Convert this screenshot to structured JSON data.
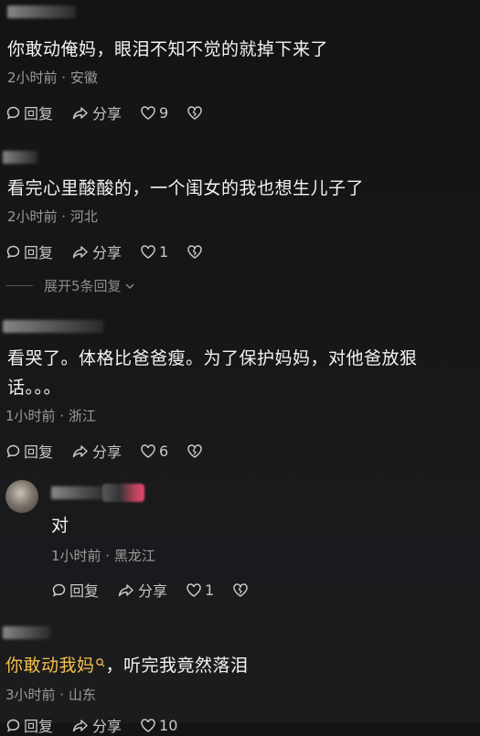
{
  "comments": [
    {
      "text": "你敢动俺妈，眼泪不知不觉的就掉下来了",
      "meta": "2小时前 · 安徽",
      "reply_label": "回复",
      "share_label": "分享",
      "likes": "9"
    },
    {
      "text": "看完心里酸酸的，一个闺女的我也想生儿子了",
      "meta": "2小时前 · 河北",
      "reply_label": "回复",
      "share_label": "分享",
      "likes": "1",
      "expand_label": "展开5条回复"
    },
    {
      "text_line1": "看哭了。体格比爸爸瘦。为了保护妈妈，对他爸放狠",
      "text_line2": "话。。。",
      "meta": "1小时前 · 浙江",
      "reply_label": "回复",
      "share_label": "分享",
      "likes": "6"
    },
    {
      "reply": true,
      "text": "对",
      "meta": "1小时前 · 黑龙江",
      "reply_label": "回复",
      "share_label": "分享",
      "likes": "1"
    },
    {
      "highlight_text": "你敢动我妈",
      "text_rest": "，听完我竟然落泪",
      "meta": "3小时前 · 山东",
      "reply_label": "回复",
      "share_label": "分享",
      "likes": "10"
    }
  ],
  "icons": {
    "reply": "comment-bubble-icon",
    "share": "share-arrow-icon",
    "like": "heart-icon",
    "dislike": "broken-heart-icon",
    "search_hint": "search-icon",
    "expand": "chevron-down-icon"
  },
  "colors": {
    "background": "#151517",
    "highlight": "#f5c04a",
    "meta": "#9b9b9b"
  }
}
